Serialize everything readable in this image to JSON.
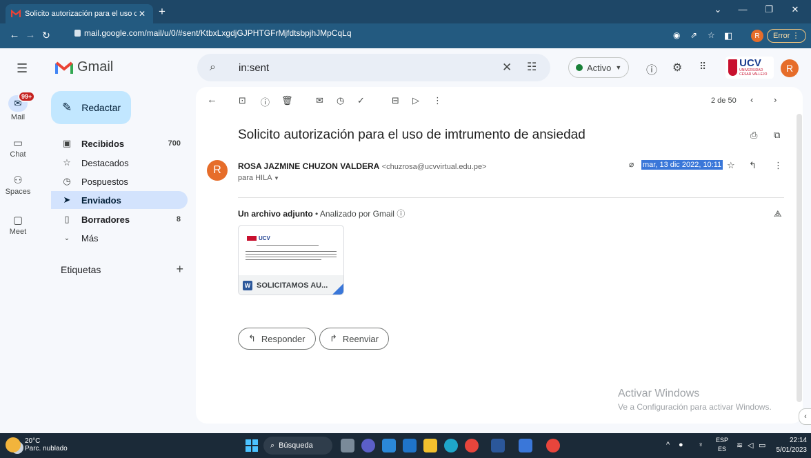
{
  "browser": {
    "tab_title": "Solicito autorización para el uso de",
    "tab_close": "✕",
    "new_tab": "+",
    "url": "mail.google.com/mail/u/0/#sent/KtbxLxgdjGJPHTGFrMjfdtsbpjhJMpCqLq",
    "profile_initial": "R",
    "error_label": "Error",
    "win_minimize": "—",
    "win_restore": "❐",
    "win_close": "✕",
    "win_collapse": "⌄"
  },
  "gmail": {
    "app_name": "Gmail",
    "search_value": "in:sent",
    "status_label": "Activo",
    "org_logo_text": "UCV",
    "org_logo_sub": "UNIVERSIDAD CÉSAR VALLEJO",
    "account_initial": "R"
  },
  "rail": {
    "mail_badge": "99+",
    "items": [
      {
        "label": "Mail",
        "icon": "mail-icon"
      },
      {
        "label": "Chat",
        "icon": "chat-icon"
      },
      {
        "label": "Spaces",
        "icon": "spaces-icon"
      },
      {
        "label": "Meet",
        "icon": "meet-icon"
      }
    ]
  },
  "nav": {
    "compose_label": "Redactar",
    "folders": [
      {
        "label": "Recibidos",
        "count": "700"
      },
      {
        "label": "Destacados",
        "count": ""
      },
      {
        "label": "Pospuestos",
        "count": ""
      },
      {
        "label": "Enviados",
        "count": ""
      },
      {
        "label": "Borradores",
        "count": "8"
      },
      {
        "label": "Más",
        "count": ""
      }
    ],
    "labels_heading": "Etiquetas"
  },
  "message": {
    "pager": "2 de 50",
    "subject": "Solicito autorización para el uso de imtrumento de ansiedad",
    "sender_initial": "R",
    "sender_name": "ROSA JAZMINE CHUZON VALDERA",
    "sender_email": "<chuzrosa@ucvvirtual.edu.pe>",
    "recipients": "para HILA",
    "date": "mar, 13 dic 2022, 10:11",
    "attachments_heading": "Un archivo adjunto",
    "attachments_scan": "Analizado por Gmail",
    "attachment_name": "SOLICITAMOS AU...",
    "attachment_icon_letter": "W",
    "reply_label": "Responder",
    "forward_label": "Reenviar"
  },
  "watermark": {
    "line1": "Activar Windows",
    "line2": "Ve a Configuración para activar Windows."
  },
  "taskbar": {
    "temperature": "20°C",
    "weather": "Parc. nublado",
    "search_label": "Búsqueda",
    "lang": "ESP",
    "lang_sub": "ES",
    "time": "22:14",
    "date": "5/01/2023"
  },
  "colors": {
    "browser_frame": "#1e4767",
    "compose_bg": "#c2e7ff",
    "active_folder": "#d3e3fd",
    "avatar": "#e66d2a",
    "selection": "#3a77d9",
    "badge": "#c5221f"
  }
}
